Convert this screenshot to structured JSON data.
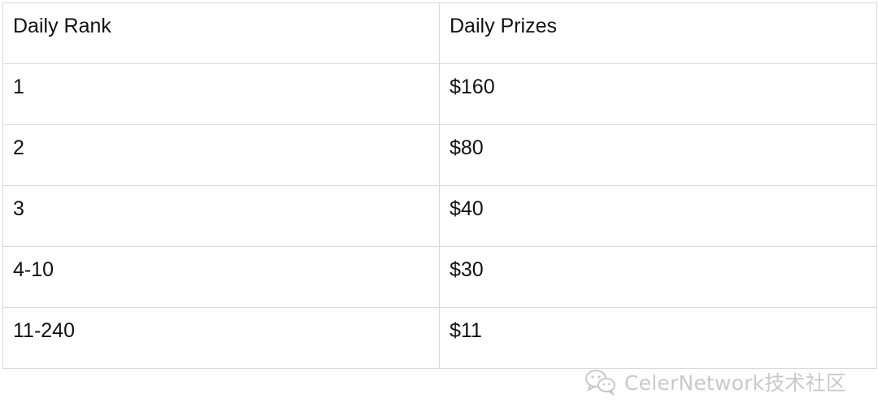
{
  "table": {
    "headers": [
      "Daily Rank",
      "Daily Prizes"
    ],
    "rows": [
      [
        "1",
        "$160"
      ],
      [
        "2",
        "$80"
      ],
      [
        "3",
        "$40"
      ],
      [
        "4-10",
        "$30"
      ],
      [
        "11-240",
        "$11"
      ]
    ]
  },
  "watermark": {
    "text": "CelerNetwork技术社区",
    "icon": "wechat-icon",
    "color": "#c9c9c9"
  }
}
